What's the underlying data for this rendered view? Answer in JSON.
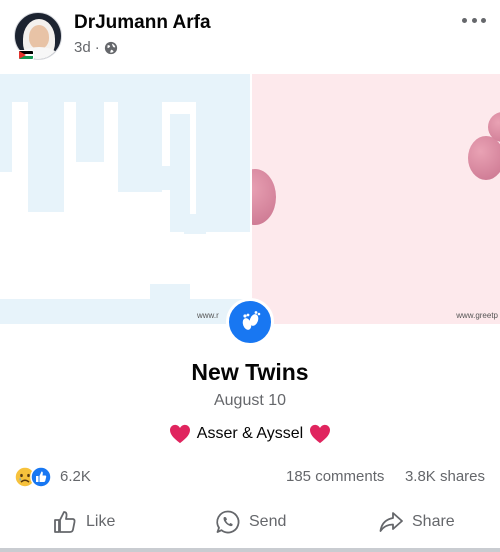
{
  "post": {
    "author": "DrJumann Arfa",
    "time": "3d",
    "separator": "·",
    "privacy_icon": "globe-icon",
    "more_icon": "more-options-icon"
  },
  "media": {
    "watermark_left": "www.r",
    "watermark_right": "www.greetp"
  },
  "event": {
    "icon": "baby-feet-icon",
    "title": "New Twins",
    "date": "August 10",
    "names": "Asser & Ayssel"
  },
  "stats": {
    "reactions": "6.2K",
    "comments": "185 comments",
    "shares": "3.8K shares"
  },
  "actions": {
    "like": "Like",
    "send": "Send",
    "share": "Share"
  },
  "colors": {
    "accent": "#1877f2",
    "heart": "#e0245e",
    "secondary_text": "#65676b"
  }
}
